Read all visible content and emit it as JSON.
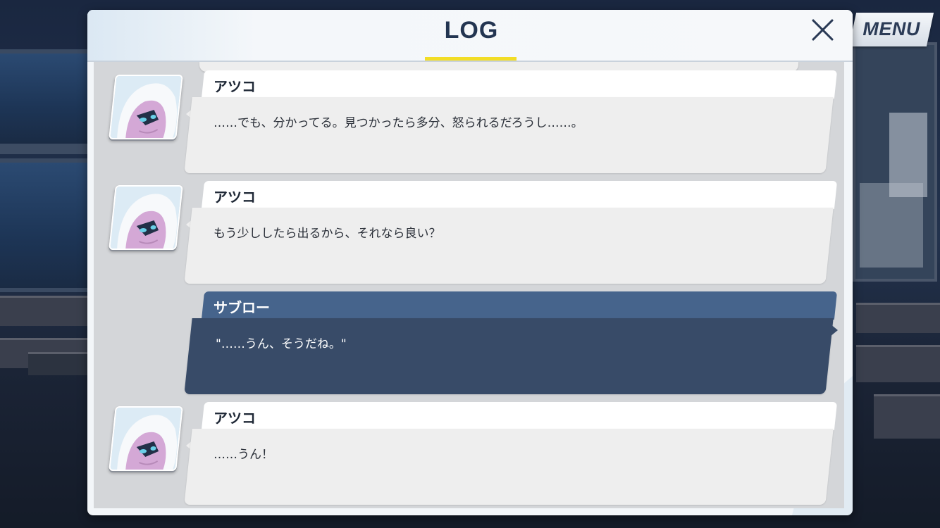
{
  "log": {
    "title": "LOG",
    "menu_label": "MENU",
    "entries": [
      {
        "speaker": "アツコ",
        "text": "……でも、分かってる。見つかったら多分、怒られるだろうし……。",
        "is_player": false,
        "avatar": "atsuko-portrait"
      },
      {
        "speaker": "アツコ",
        "text": "もう少ししたら出るから、それなら良い？",
        "is_player": false,
        "avatar": "atsuko-portrait"
      },
      {
        "speaker": "サブロー",
        "text": "\"……うん、そうだね。\"",
        "is_player": true
      },
      {
        "speaker": "アツコ",
        "text": "……うん！",
        "is_player": false,
        "avatar": "atsuko-portrait"
      }
    ]
  },
  "colors": {
    "title_underline": "#f2dd26",
    "player_name_bar": "#46648c",
    "player_body": "#384b68",
    "npc_body": "#eeeeee"
  },
  "icons": {
    "close": "close-icon"
  }
}
